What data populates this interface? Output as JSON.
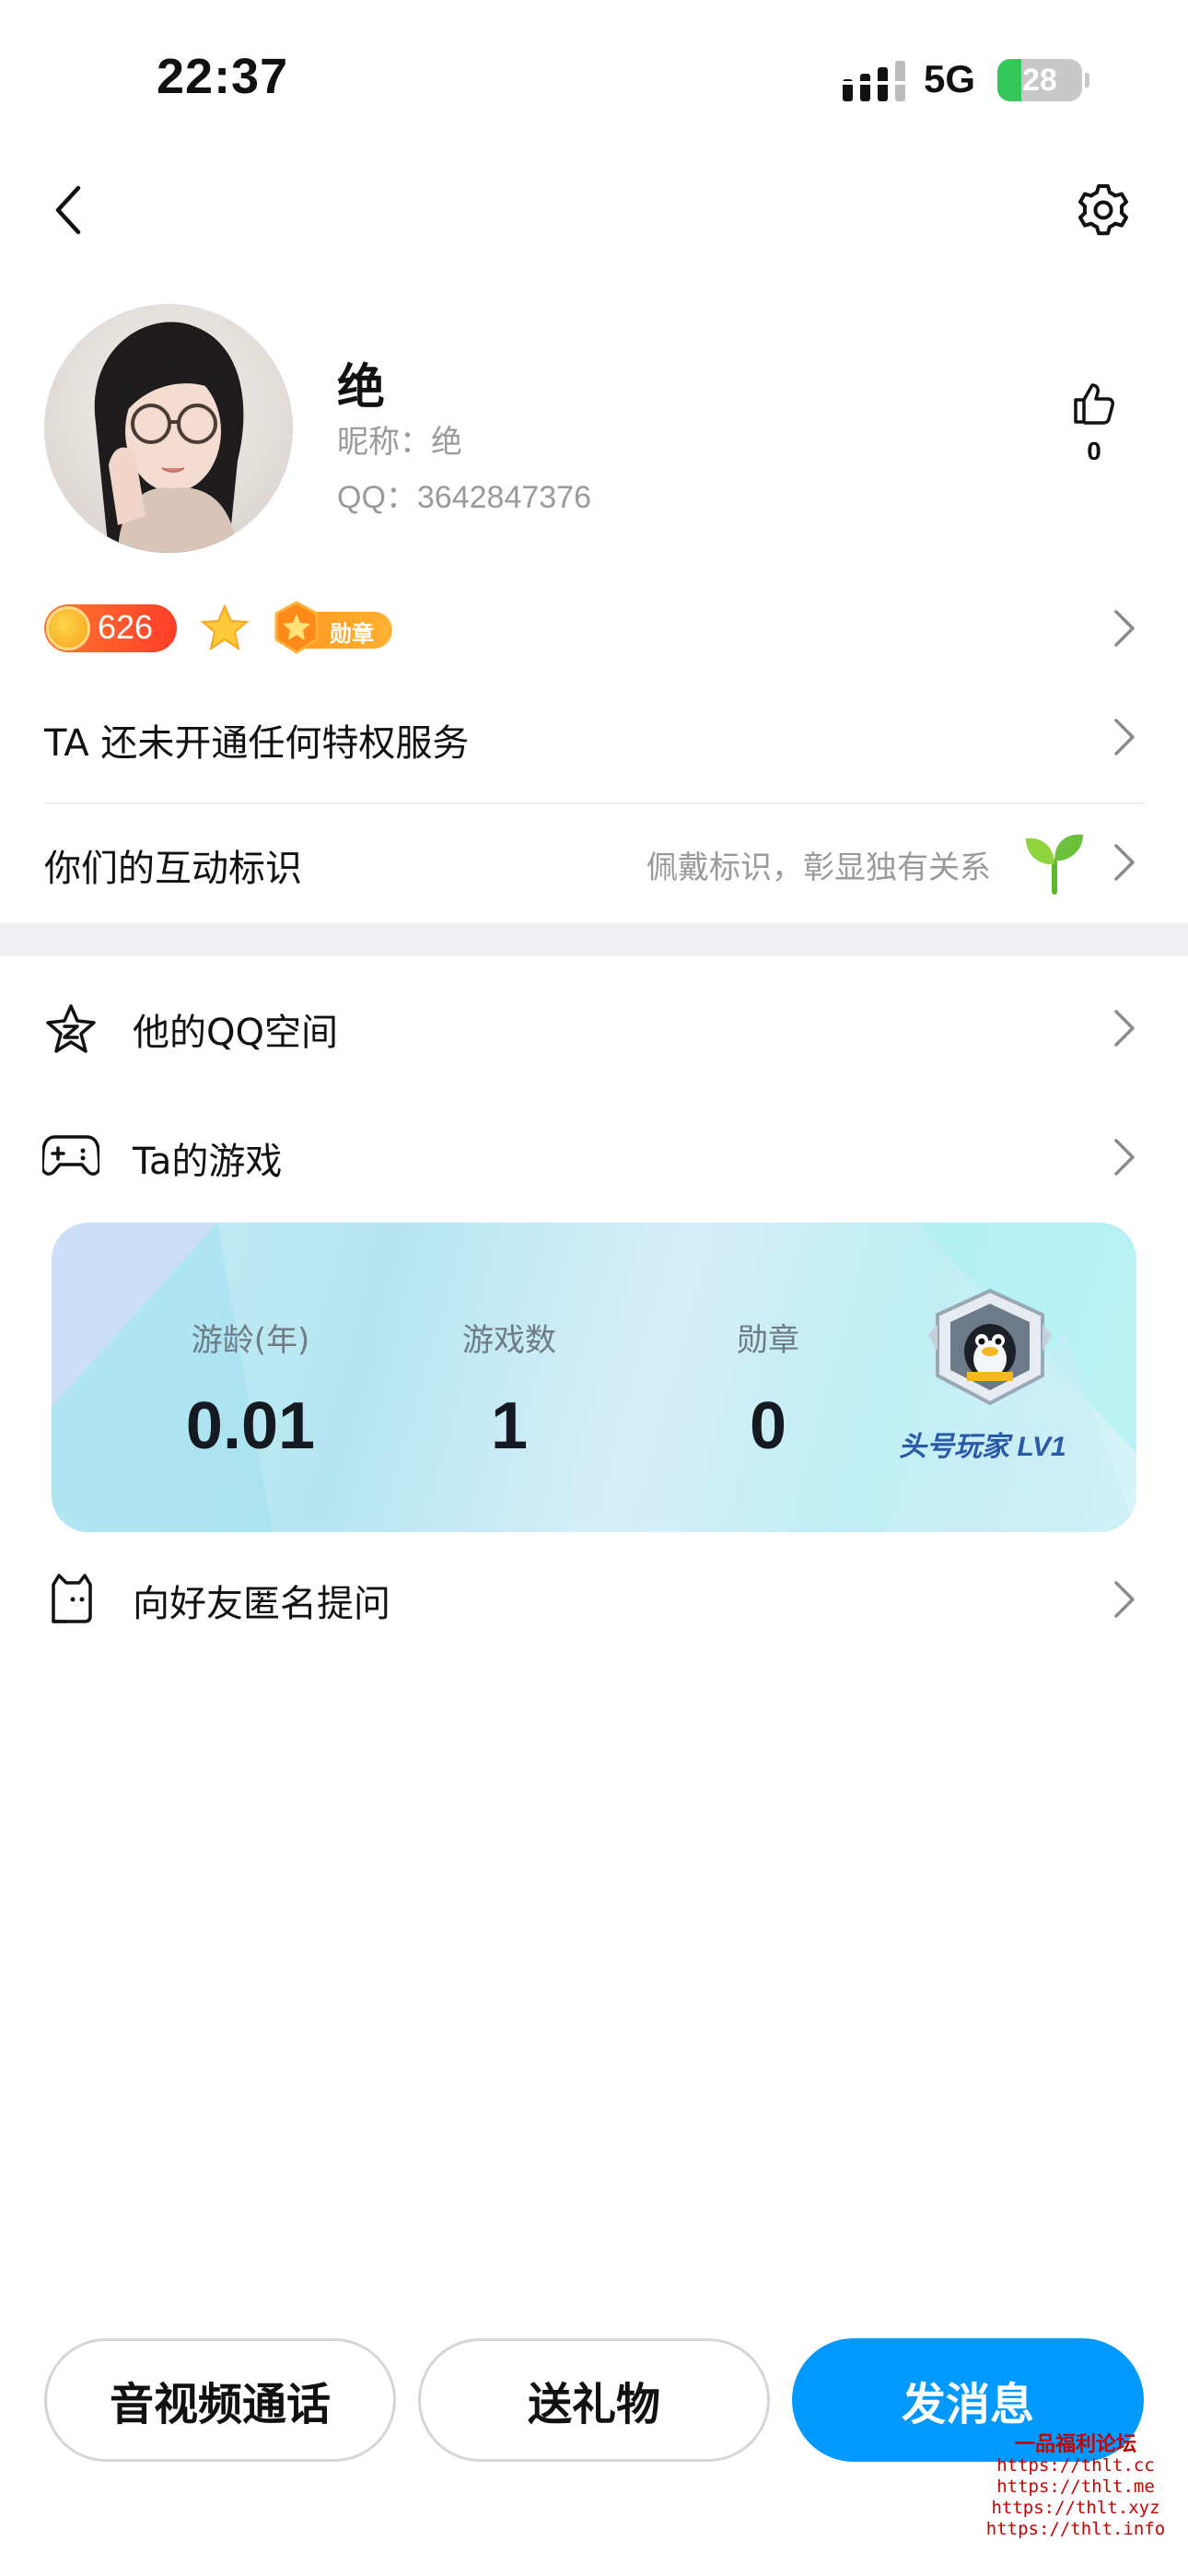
{
  "status_bar": {
    "time": "22:37",
    "network": "5G",
    "battery_percent": "28",
    "battery_level": 0.28,
    "signal_icon": "signal-bars-icon",
    "charging_icon": "bolt-icon"
  },
  "nav": {
    "back_icon": "chevron-left-icon",
    "settings_icon": "gear-icon"
  },
  "profile": {
    "display_name": "绝",
    "nickname_line": "昵称：绝",
    "qq_line": "QQ：3642847376",
    "like_count": "0",
    "like_icon": "thumbs-up-icon"
  },
  "badges": {
    "level": "626",
    "medal_label": "勋章"
  },
  "rows": {
    "privilege": "TA 还未开通任何特权服务",
    "interaction_title": "你们的互动标识",
    "interaction_hint": "佩戴标识，彰显独有关系",
    "qzone": "他的QQ空间",
    "games": "Ta的游戏",
    "anonymous": "向好友匿名提问"
  },
  "game_card": {
    "stats": [
      {
        "label": "游龄(年)",
        "value": "0.01"
      },
      {
        "label": "游戏数",
        "value": "1"
      },
      {
        "label": "勋章",
        "value": "0"
      }
    ],
    "badge_title": "头号玩家 LV1"
  },
  "actions": {
    "call": "音视频通话",
    "gift": "送礼物",
    "message": "发消息"
  },
  "watermark": {
    "title": "一品福利论坛",
    "lines": [
      "https://thlt.cc",
      "https://thlt.me",
      "https://thlt.xyz",
      "https://thlt.info"
    ]
  },
  "colors": {
    "accent": "#0099ff",
    "hint_text": "#9a9a9a",
    "section_bg": "#f0f0f2",
    "level_pill": "#ff4a2a",
    "medal": "#ff9a1f"
  }
}
